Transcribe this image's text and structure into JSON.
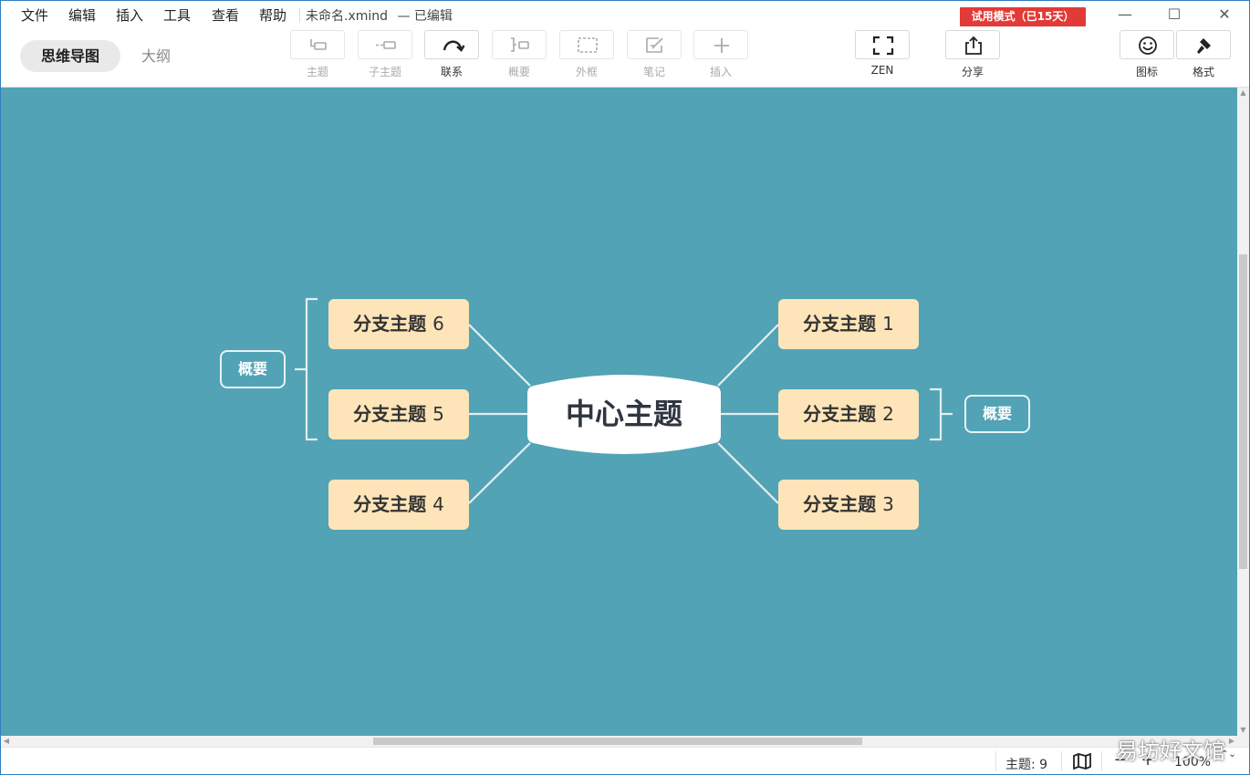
{
  "menu": {
    "items": [
      "文件",
      "编辑",
      "插入",
      "工具",
      "查看",
      "帮助"
    ],
    "document_title": "未命名.xmind",
    "status": "— 已编辑",
    "trial_badge": "试用模式（已15天）"
  },
  "window_controls": {
    "minimize": "—",
    "maximize": "☐",
    "close": "✕"
  },
  "view_tabs": {
    "mindmap": "思维导图",
    "outline": "大纲"
  },
  "toolbar": {
    "topic": "主题",
    "subtopic": "子主题",
    "relationship": "联系",
    "summary": "概要",
    "boundary": "外框",
    "note": "笔记",
    "insert": "插入",
    "zen": "ZEN",
    "share": "分享",
    "icon": "图标",
    "format": "格式"
  },
  "mindmap": {
    "central_topic": "中心主题",
    "branch_prefix": "分支主题",
    "branches": [
      {
        "label": "分支主题",
        "number": "1"
      },
      {
        "label": "分支主题",
        "number": "2"
      },
      {
        "label": "分支主题",
        "number": "3"
      },
      {
        "label": "分支主题",
        "number": "4"
      },
      {
        "label": "分支主题",
        "number": "5"
      },
      {
        "label": "分支主题",
        "number": "6"
      }
    ],
    "summary_left": "概要",
    "summary_right": "概要"
  },
  "colors": {
    "canvas": "#52a3b5",
    "branch_fill": "#fde5b9",
    "central_fill": "#ffffff",
    "connector": "#e3eff2",
    "trial_badge": "#e23a36"
  },
  "statusbar": {
    "topic_count": "主题: 9",
    "zoom_out": "−",
    "zoom_in": "+",
    "zoom_level": "100%",
    "zoom_arrows": "⌃⌄"
  },
  "watermark": "易坊好文馆"
}
